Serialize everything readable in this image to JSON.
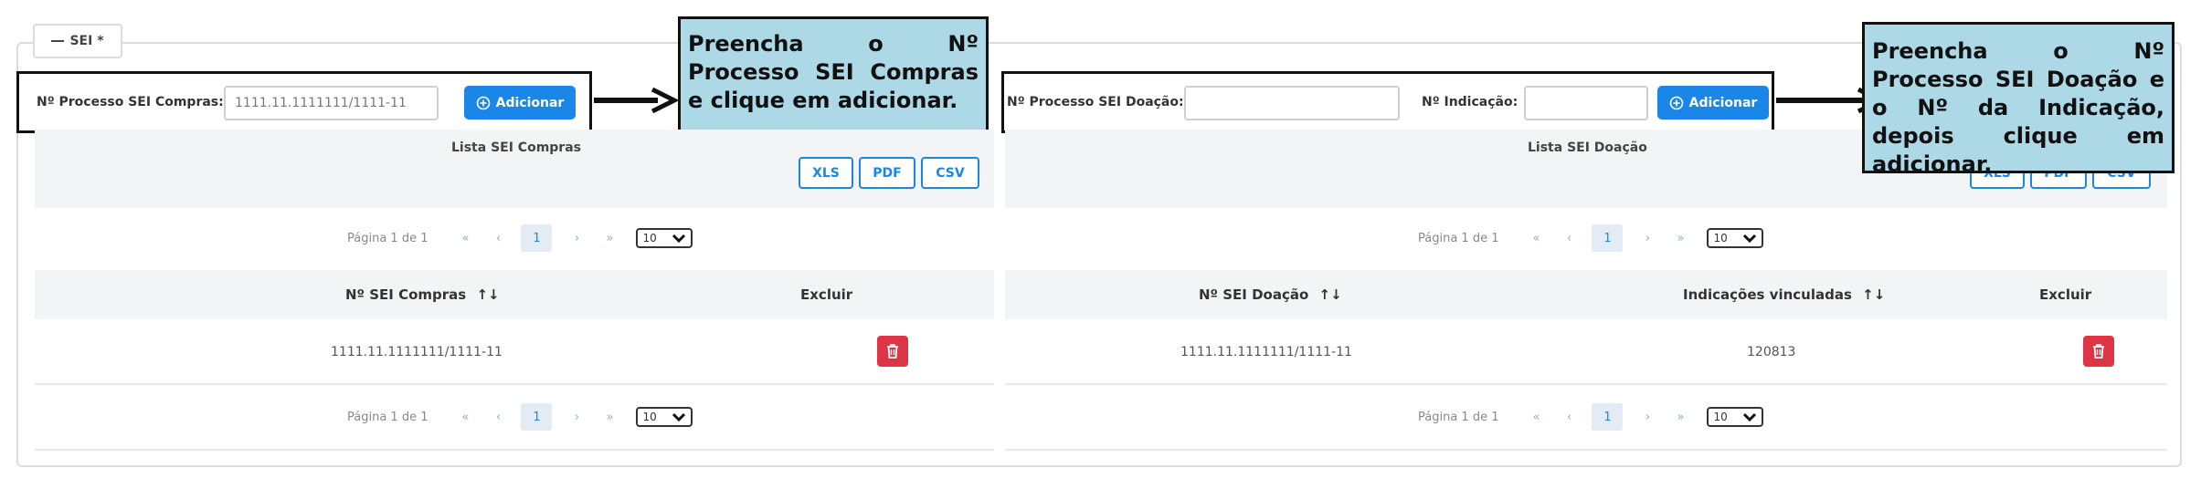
{
  "fieldset": {
    "legend_label": "SEI *",
    "collapse_icon": "minus-icon"
  },
  "compras": {
    "label": "Nº Processo SEI Compras:",
    "input_value": "1111.11.1111111/1111-11",
    "add_label": "Adicionar",
    "list_title": "Lista SEI Compras",
    "export_buttons": [
      "XLS",
      "PDF",
      "CSV"
    ],
    "columns": [
      "Nº SEI Compras",
      "Excluir"
    ],
    "rows": [
      {
        "sei": "1111.11.1111111/1111-11"
      }
    ],
    "pager": {
      "text": "Página 1 de 1",
      "first": "«",
      "prev": "‹",
      "page": "1",
      "next": "›",
      "last": "»",
      "page_size": "10"
    }
  },
  "doacao": {
    "label": "Nº Processo SEI Doação:",
    "input_value": "",
    "indicacao_label": "Nº Indicação:",
    "indicacao_value": "",
    "add_label": "Adicionar",
    "list_title": "Lista SEI Doação",
    "export_buttons": [
      "XLS",
      "PDF",
      "CSV"
    ],
    "columns": [
      "Nº SEI Doação",
      "Indicações vinculadas",
      "Excluir"
    ],
    "rows": [
      {
        "sei": "1111.11.1111111/1111-11",
        "indicacoes": "120813"
      }
    ],
    "pager": {
      "text": "Página 1 de 1",
      "first": "«",
      "prev": "‹",
      "page": "1",
      "next": "›",
      "last": "»",
      "page_size": "10"
    }
  },
  "callouts": {
    "compras": "Preencha o Nº Processo SEI Compras e clique em adicionar.",
    "doacao": "Preencha o Nº Processo SEI Doação e o Nº da Indicação, depois clique em adicionar."
  },
  "colors": {
    "accent": "#1a86e8",
    "danger": "#dc3545",
    "callout_bg": "#add8e6"
  },
  "icons": {
    "add": "plus-circle-icon",
    "delete": "trash-icon",
    "sort": "sort-icon",
    "dropdown": "chevron-down-icon",
    "arrow": "arrow-right-icon"
  }
}
